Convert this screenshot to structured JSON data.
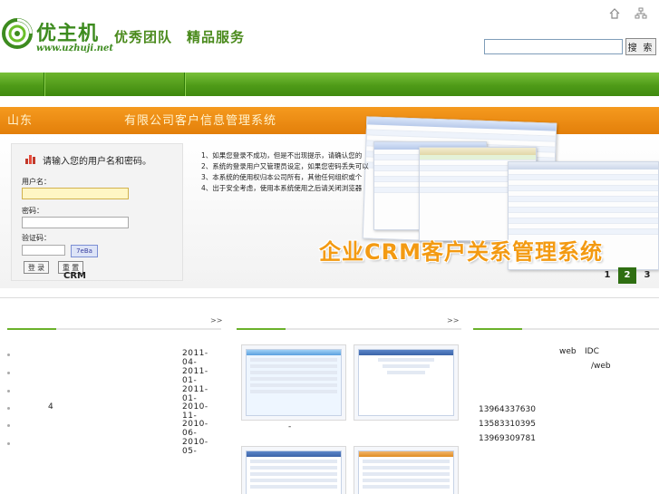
{
  "header": {
    "logo_text": "优主机",
    "logo_url": "www.uzhuji.net",
    "slogan": "优秀团队　精品服务",
    "search_placeholder": "",
    "search_button": "搜 索",
    "icons": [
      "home-icon",
      "sitemap-icon"
    ]
  },
  "colors": {
    "brand_green": "#4f9b18",
    "banner_orange": "#e37f0a",
    "crm_orange": "#f39a12",
    "pager_active": "#2f6e12"
  },
  "banner": {
    "title_a": "山东",
    "title_b": "有限公司客户信息管理系统",
    "login": {
      "prompt": "请输入您的用户名和密码。",
      "username_label": "用户名：",
      "password_label": "密码：",
      "captcha_label": "验证码：",
      "captcha_text": "7eBa",
      "login_button": "登 录",
      "reset_button": "重 置",
      "crm_label": "CRM"
    },
    "notice_lines": [
      "1、如果您登录不成功，但是不出现提示，请确认您的",
      "2、系统的登录用户又管理员设定，如果您密码丢失可以",
      "3、本系统的使用权归本公司所有，其他任何组织或个",
      "4、出于安全考虑，使用本系统使用之后请关闭浏览器"
    ],
    "crm_headline": "企业CRM客户关系管理系统",
    "pager": [
      "1",
      "2",
      "3"
    ],
    "pager_active": "2"
  },
  "content": {
    "more_label": ">>",
    "news": [
      {
        "title": "",
        "date": "2011-04-"
      },
      {
        "title": "",
        "date": "2011-01-"
      },
      {
        "title": "",
        "date": "2011-01-"
      },
      {
        "title": "4",
        "date": "2010-11-"
      },
      {
        "title": "",
        "date": "2010-06-"
      },
      {
        "title": "",
        "date": "2010-05-"
      }
    ],
    "thumb_caption": "-",
    "contact": {
      "line1_a": "web",
      "line1_b": "IDC",
      "line2": "/web",
      "phones": [
        "13964337630",
        "13583310395",
        "13969309781"
      ]
    }
  }
}
